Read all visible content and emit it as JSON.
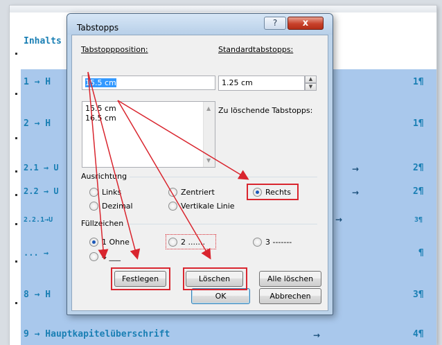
{
  "document": {
    "heading": "Inhalts",
    "rows": [
      {
        "prefix": "1 → H",
        "page": "1¶"
      },
      {
        "prefix": "2 → H",
        "page": "1¶"
      },
      {
        "prefix": "2.1 → U",
        "arrow": "→",
        "page": "2¶"
      },
      {
        "prefix": "2.2 → U",
        "arrow": "→",
        "page": "2¶"
      },
      {
        "prefix": "2.2.1→U",
        "arrow": "→",
        "page": "3¶"
      },
      {
        "prefix": "... →",
        "page": "¶"
      },
      {
        "prefix": "8 → H",
        "page": "3¶"
      },
      {
        "prefix": "9 → Hauptkapitelüberschrift",
        "arrow": "→",
        "page": "4¶"
      }
    ]
  },
  "dialog": {
    "title": "Tabstopps",
    "help_label": "?",
    "close_label": "x",
    "tab_position_label": "Tabstoppposition:",
    "tab_position_value": "15.5 cm",
    "tab_list": [
      "15.5 cm",
      "16.5 cm"
    ],
    "default_tabs_label": "Standardtabstopps:",
    "default_tabs_value": "1.25 cm",
    "to_clear_label": "Zu löschende Tabstopps:",
    "alignment": {
      "label": "Ausrichtung",
      "options": [
        "Links",
        "Zentriert",
        "Rechts",
        "Dezimal",
        "Vertikale Linie"
      ],
      "selected": "Rechts"
    },
    "leader": {
      "label": "Füllzeichen",
      "options": [
        "1 Ohne",
        "2 .......",
        "3 -------",
        "4 ___"
      ],
      "selected": "1 Ohne"
    },
    "buttons": {
      "set": "Festlegen",
      "clear": "Löschen",
      "clear_all": "Alle löschen",
      "ok": "OK",
      "cancel": "Abbrechen"
    }
  },
  "colors": {
    "annotation_red": "#d9252e",
    "highlight": "#a9c8ec",
    "doc_text": "#1a7fb4"
  }
}
